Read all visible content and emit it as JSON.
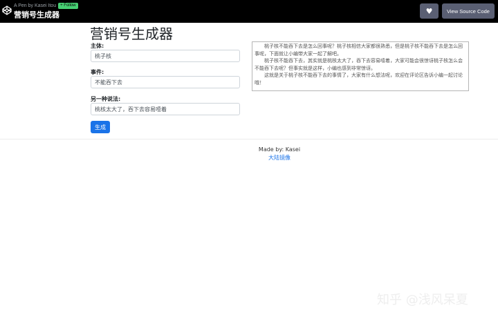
{
  "topbar": {
    "pen_by": "A Pen by Kasei Itou",
    "follow_label": "+ Follow",
    "pen_title": "营销号生成器",
    "heart_icon": "heart-icon",
    "source_button_label": "View Source Code"
  },
  "form": {
    "title": "营销号生成器",
    "subject_label": "主体:",
    "subject_value": "桃子核",
    "event_label": "事件:",
    "event_value": "不能吞下去",
    "alt_label": "另一种说法:",
    "alt_value": "桃核太大了，吞下去容易噎着",
    "generate_label": "生成"
  },
  "output": {
    "paragraphs": [
      "桃子核不能吞下去是怎么回事呢？桃子核相信大家都很熟悉，但是桃子核不能吞下去是怎么回事呢，下面就让小编带大家一起了解吧。",
      "桃子核不能吞下去，其实就是桃核太大了，吞下去容易噎着，大家可能会很惊讶桃子核怎么会不能吞下去呢？但事实就是这样，小编也感到非常惊讶。",
      "这就是关于桃子核不能吞下去的事情了，大家有什么想法呢，欢迎在评论区告诉小编一起讨论哦！"
    ]
  },
  "footer": {
    "made_by": "Made by: Kasei",
    "mirror_link": "大陆镜像"
  },
  "watermark": "知乎 @浅风呆夏",
  "colors": {
    "accent": "#1a73e8",
    "follow_green": "#47cf73",
    "topbar_bg": "#000000",
    "button_bg": "#5a5f73"
  }
}
